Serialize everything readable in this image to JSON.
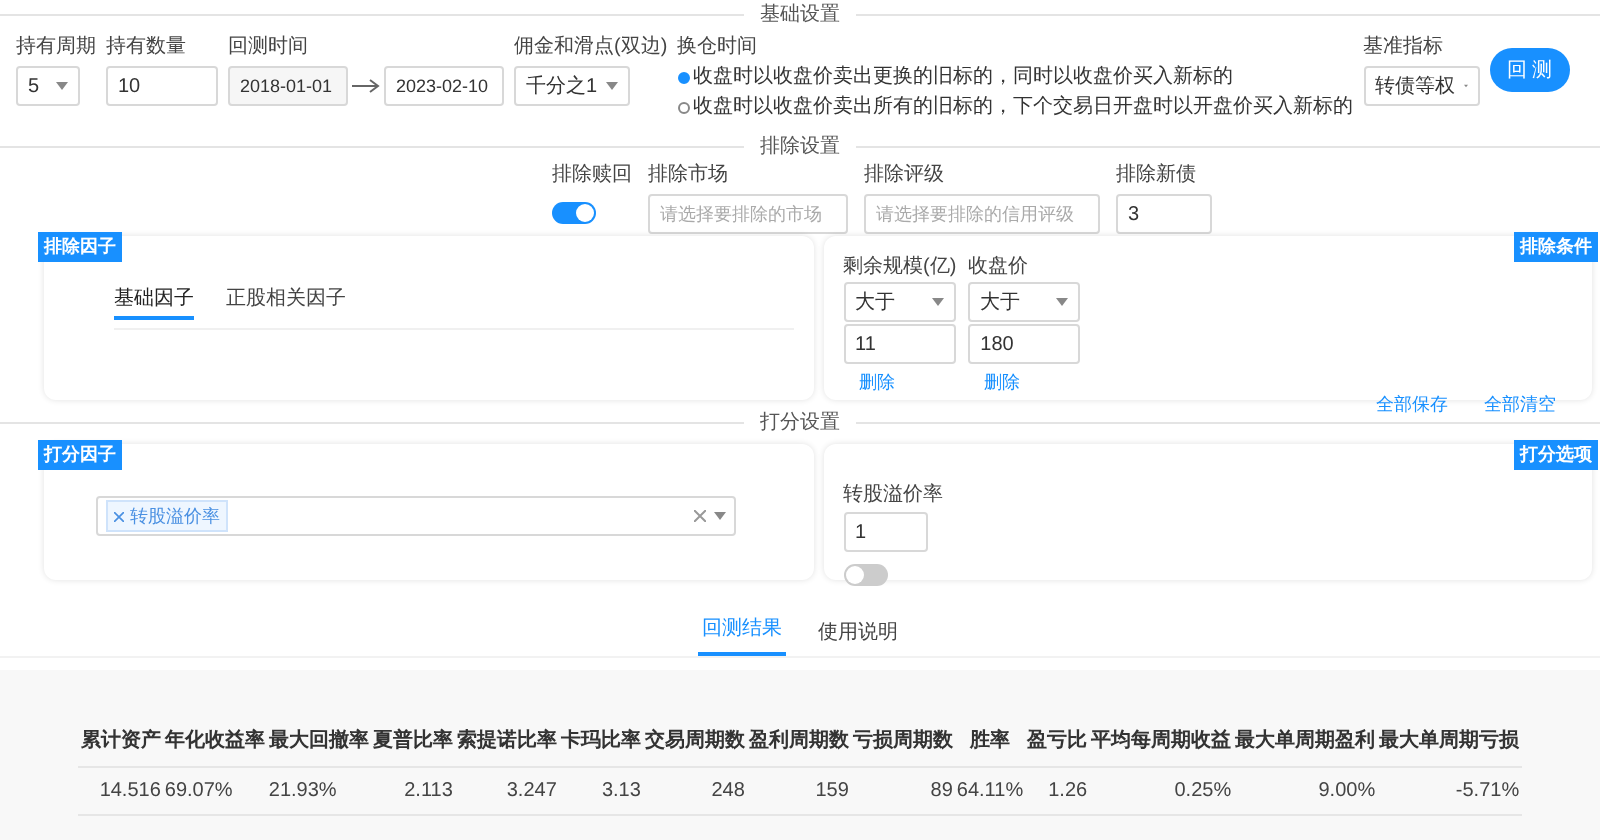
{
  "basic_settings": {
    "title": "基础设置",
    "hold_period": {
      "label": "持有周期",
      "value": "5"
    },
    "hold_count": {
      "label": "持有数量",
      "value": "10"
    },
    "backtest_time": {
      "label": "回测时间",
      "start": "2018-01-01",
      "end": "2023-02-10"
    },
    "commission": {
      "label": "佣金和滑点(双边)",
      "value": "千分之1"
    },
    "rebalance": {
      "label": "换仓时间",
      "options": [
        {
          "label": "收盘时以收盘价卖出更换的旧标的，同时以收盘价买入新标的",
          "selected": true
        },
        {
          "label": "收盘时以收盘价卖出所有的旧标的，下个交易日开盘时以开盘价买入新标的",
          "selected": false
        }
      ]
    },
    "benchmark": {
      "label": "基准指标",
      "value": "转债等权"
    },
    "run_button": "回 测"
  },
  "exclude_settings": {
    "title": "排除设置",
    "exclude_redeem": {
      "label": "排除赎回",
      "on": true
    },
    "exclude_market": {
      "label": "排除市场",
      "placeholder": "请选择要排除的市场"
    },
    "exclude_rating": {
      "label": "排除评级",
      "placeholder": "请选择要排除的信用评级"
    },
    "exclude_new": {
      "label": "排除新债",
      "value": "3"
    }
  },
  "exclude_factors": {
    "tag": "排除因子",
    "tabs": [
      {
        "label": "基础因子",
        "selected": true
      },
      {
        "label": "正股相关因子",
        "selected": false
      }
    ]
  },
  "exclude_conditions": {
    "tag": "排除条件",
    "conditions": [
      {
        "label": "剩余规模(亿)",
        "operator": "大于",
        "value": "11",
        "delete": "删除"
      },
      {
        "label": "收盘价",
        "operator": "大于",
        "value": "180",
        "delete": "删除"
      }
    ],
    "save_all": "全部保存",
    "clear_all": "全部清空"
  },
  "score_settings": {
    "title": "打分设置"
  },
  "score_factors": {
    "tag": "打分因子",
    "chips": [
      "转股溢价率"
    ]
  },
  "score_options": {
    "tag": "打分选项",
    "items": [
      {
        "label": "转股溢价率",
        "value": "1",
        "on": false
      }
    ]
  },
  "result_tabs": [
    {
      "label": "回测结果",
      "selected": true
    },
    {
      "label": "使用说明",
      "selected": false
    }
  ],
  "results_table": {
    "columns": [
      "累计资产",
      "年化收益率",
      "最大回撤率",
      "夏普比率",
      "索提诺比率",
      "卡玛比率",
      "交易周期数",
      "盈利周期数",
      "亏损周期数",
      "胜率",
      "盈亏比",
      "平均每周期收益",
      "最大单周期盈利",
      "最大单周期亏损"
    ],
    "rows": [
      [
        "14.516",
        "69.07%",
        "21.93%",
        "2.113",
        "3.247",
        "3.13",
        "248",
        "159",
        "89",
        "64.11%",
        "1.26",
        "0.25%",
        "9.00%",
        "-5.71%"
      ]
    ]
  }
}
